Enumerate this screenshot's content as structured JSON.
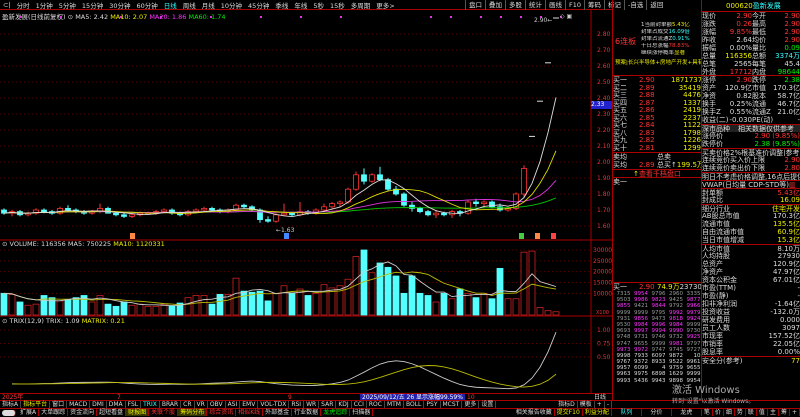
{
  "topbar": {
    "tabs": [
      "分时",
      "1分钟",
      "5分钟",
      "15分钟",
      "30分钟",
      "60分钟",
      "日线",
      "周线",
      "月线",
      "10分钟",
      "45分钟",
      "季线",
      "年线",
      "5秒",
      "15秒",
      "多周期",
      "更多>"
    ],
    "active": "日线",
    "right": [
      "盘口",
      "叠加",
      "多股",
      "统计",
      "画线",
      "F10",
      "筹码",
      "标记",
      "-自选",
      "返回"
    ]
  },
  "chart": {
    "title": "盈新发展(日线前复权)",
    "ma5": "MA5: 2.42",
    "ma10": "MA10: 2.07",
    "ma20": "MA20: 1.86",
    "ma60": "MA60: 1.74",
    "current_tag": "2.33",
    "high_label": "2.90",
    "low_label": "1.63",
    "price_ticks": [
      "2.80",
      "2.70",
      "2.60",
      "2.50",
      "2.40",
      "2.30",
      "2.20",
      "2.10",
      "2.00",
      "1.90",
      "1.80",
      "1.70",
      "1.60"
    ],
    "candles": [
      [
        1.7,
        1.71,
        1.67,
        1.68
      ],
      [
        1.68,
        1.7,
        1.66,
        1.69
      ],
      [
        1.69,
        1.7,
        1.66,
        1.67
      ],
      [
        1.67,
        1.69,
        1.66,
        1.68
      ],
      [
        1.68,
        1.71,
        1.67,
        1.7
      ],
      [
        1.7,
        1.71,
        1.68,
        1.69
      ],
      [
        1.69,
        1.7,
        1.67,
        1.68
      ],
      [
        1.68,
        1.72,
        1.67,
        1.71
      ],
      [
        1.71,
        1.73,
        1.69,
        1.7
      ],
      [
        1.7,
        1.71,
        1.68,
        1.69
      ],
      [
        1.69,
        1.7,
        1.67,
        1.68
      ],
      [
        1.68,
        1.7,
        1.67,
        1.69
      ],
      [
        1.69,
        1.74,
        1.68,
        1.71
      ],
      [
        1.71,
        1.72,
        1.68,
        1.68
      ],
      [
        1.68,
        1.69,
        1.66,
        1.67
      ],
      [
        1.67,
        1.68,
        1.65,
        1.66
      ],
      [
        1.66,
        1.68,
        1.65,
        1.67
      ],
      [
        1.67,
        1.69,
        1.66,
        1.68
      ],
      [
        1.68,
        1.69,
        1.67,
        1.68
      ],
      [
        1.68,
        1.7,
        1.67,
        1.69
      ],
      [
        1.69,
        1.71,
        1.68,
        1.7
      ],
      [
        1.7,
        1.71,
        1.67,
        1.68
      ],
      [
        1.68,
        1.69,
        1.66,
        1.67
      ],
      [
        1.67,
        1.7,
        1.66,
        1.69
      ],
      [
        1.69,
        1.71,
        1.68,
        1.7
      ],
      [
        1.7,
        1.72,
        1.69,
        1.71
      ],
      [
        1.71,
        1.72,
        1.69,
        1.7
      ],
      [
        1.7,
        1.71,
        1.68,
        1.69
      ],
      [
        1.69,
        1.71,
        1.68,
        1.7
      ],
      [
        1.7,
        1.74,
        1.69,
        1.73
      ],
      [
        1.73,
        1.74,
        1.71,
        1.72
      ],
      [
        1.72,
        1.73,
        1.69,
        1.7
      ],
      [
        1.7,
        1.71,
        1.62,
        1.64
      ],
      [
        1.64,
        1.66,
        1.62,
        1.63
      ],
      [
        1.63,
        1.68,
        1.62,
        1.67
      ],
      [
        1.67,
        1.74,
        1.66,
        1.68
      ],
      [
        1.68,
        1.69,
        1.66,
        1.67
      ],
      [
        1.67,
        1.75,
        1.66,
        1.69
      ],
      [
        1.69,
        1.7,
        1.67,
        1.68
      ],
      [
        1.68,
        1.71,
        1.67,
        1.7
      ],
      [
        1.7,
        1.74,
        1.69,
        1.72
      ],
      [
        1.72,
        1.75,
        1.71,
        1.74
      ],
      [
        1.74,
        1.76,
        1.72,
        1.75
      ],
      [
        1.75,
        1.84,
        1.74,
        1.83
      ],
      [
        1.83,
        1.94,
        1.82,
        1.92
      ],
      [
        1.92,
        1.96,
        1.86,
        1.88
      ],
      [
        1.88,
        1.93,
        1.87,
        1.92
      ],
      [
        1.92,
        1.97,
        1.88,
        1.89
      ],
      [
        1.89,
        1.9,
        1.82,
        1.83
      ],
      [
        1.83,
        1.85,
        1.79,
        1.8
      ],
      [
        1.8,
        1.81,
        1.72,
        1.73
      ],
      [
        1.73,
        1.75,
        1.69,
        1.71
      ],
      [
        1.71,
        1.72,
        1.68,
        1.69
      ],
      [
        1.69,
        1.7,
        1.66,
        1.67
      ],
      [
        1.67,
        1.7,
        1.65,
        1.68
      ],
      [
        1.68,
        1.69,
        1.66,
        1.67
      ],
      [
        1.67,
        1.7,
        1.65,
        1.69
      ],
      [
        1.69,
        1.7,
        1.66,
        1.68
      ],
      [
        1.68,
        1.76,
        1.67,
        1.75
      ],
      [
        1.75,
        1.77,
        1.72,
        1.74
      ],
      [
        1.74,
        1.76,
        1.71,
        1.75
      ],
      [
        1.75,
        1.76,
        1.71,
        1.72
      ],
      [
        1.72,
        1.74,
        1.69,
        1.7
      ],
      [
        1.7,
        1.72,
        1.69,
        1.71
      ],
      [
        1.71,
        1.81,
        1.7,
        1.8
      ],
      [
        1.8,
        1.98,
        1.78,
        1.96
      ],
      [
        2.16,
        2.16,
        2.16,
        2.16
      ],
      [
        2.38,
        2.38,
        2.38,
        2.38
      ],
      [
        2.62,
        2.62,
        2.62,
        2.62
      ],
      [
        2.9,
        2.9,
        2.9,
        2.9
      ]
    ]
  },
  "volume": {
    "label": "VOLUME: 116356",
    "ma5": "MA5: 750225",
    "ma10": "MA10: 1120331",
    "ticks": [
      "30000",
      "25000",
      "20000",
      "15000",
      "10000"
    ],
    "unit": "X100",
    "values": [
      10000,
      9500,
      6000,
      4500,
      5000,
      9000,
      8000,
      6500,
      7000,
      8000,
      9000,
      6000,
      9000,
      5000,
      4000,
      6000,
      4500,
      5000,
      4000,
      4000,
      5000,
      4000,
      5500,
      8000,
      9000,
      9000,
      5000,
      9500,
      9500,
      17000,
      11000,
      10500,
      11000,
      6500,
      10000,
      13500,
      10000,
      12000,
      9000,
      10000,
      14000,
      12500,
      13500,
      16500,
      27000,
      30000,
      19500,
      24000,
      22000,
      18000,
      10000,
      18000,
      10000,
      9000,
      6000,
      10000,
      7500,
      12000,
      10000,
      8000,
      10000,
      7500,
      21500,
      7500,
      7500,
      29000,
      29500,
      3500,
      2000,
      1500
    ]
  },
  "trix": {
    "label": "TRIX(12,9)",
    "trix": "TRIX: 1.09",
    "matrix": "MATRIX: 0.21",
    "ticks": [
      "1.00",
      "0.75",
      "0.50"
    ]
  },
  "dateaxis": {
    "year": "2025年",
    "m7": "7",
    "m9": "9",
    "m10": "10",
    "cursor": "2025/09/12/五  26 显示涨幅99.59%",
    "period": "日线"
  },
  "indicators": {
    "items": [
      "指标A",
      "指标平台",
      "窗口",
      "MACD",
      "DMI",
      "DMA",
      "FSL",
      "TRIX",
      "BRAR",
      "CR",
      "VR",
      "OBV",
      "ASI",
      "EMV",
      "VOL-TDX",
      "RSI",
      "WR",
      "SAR",
      "KDJ",
      "CCI",
      "ROC",
      "MTM",
      "BOLL",
      "PSY",
      "MCST",
      "更多",
      "设置"
    ],
    "active": "TRIX",
    "right": [
      "指标D",
      "模板",
      "+",
      "-"
    ]
  },
  "bottombar": {
    "items": [
      "扩展A",
      "大单跟踪",
      "资金流向",
      "超短看盘",
      "财报图",
      "关联个股",
      "筹码分布",
      "综合资讯",
      "相似K线",
      "外部基金",
      "行业数据",
      "龙虎追踪",
      "扫描器"
    ],
    "right": [
      "相关报告收藏",
      "提交F10",
      "利益分配"
    ],
    "tabs": [
      "队列",
      "分价",
      "龙虎",
      "笔",
      "价",
      "细",
      "势",
      "联",
      "值",
      "主",
      "筹",
      "+"
    ]
  },
  "orderbook": {
    "board": "6连板",
    "stats": [
      [
        "1当前封单额",
        "5.43亿"
      ],
      [
        "封单占成交",
        "16.09倍"
      ],
      [
        "封单占流通Z",
        "0.91%"
      ],
      [
        "十日总涨幅",
        "78.83%"
      ],
      [
        "继续涨停概率",
        "显著"
      ]
    ],
    "concept": "预案|长兴半导体+房地产开发+具有",
    "bids": [
      [
        "买一",
        "2.90",
        "1871737"
      ],
      [
        "买二",
        "2.89",
        "35419"
      ],
      [
        "买三",
        "2.88",
        "4476"
      ],
      [
        "买四",
        "2.87",
        "1337"
      ],
      [
        "买五",
        "2.86",
        "2419"
      ],
      [
        "买六",
        "2.85",
        "2237"
      ],
      [
        "买七",
        "2.84",
        "1122"
      ],
      [
        "买八",
        "2.83",
        "1798"
      ],
      [
        "买九",
        "2.82",
        "1226"
      ],
      [
        "买十",
        "2.81",
        "1299"
      ]
    ],
    "ask_avg_label": "卖均",
    "ask_total_label": "总卖",
    "bid_avg_label": "买均",
    "bid_avg": "2.89",
    "bid_total_label": "总买↑",
    "bid_total": "199.5万",
    "view_depth": "查看千档盘口",
    "ask1": "卖一",
    "queue_header": [
      "买一",
      "2.90",
      "74.9万",
      "23730笔"
    ],
    "queue": [
      [
        "7315",
        "9954",
        "9796",
        "2960",
        "3335"
      ],
      [
        "9503",
        "9986",
        "9823",
        "9425",
        "9877"
      ],
      [
        "9855",
        "9421",
        "9844",
        "9792",
        "9966"
      ],
      [
        "9999",
        "9999",
        "9795",
        "9992",
        "9979"
      ],
      [
        "7931",
        "9856",
        "9473",
        "9818",
        "9924"
      ],
      [
        "9530",
        "9984",
        "9996",
        "9984",
        "9999"
      ],
      [
        "9693",
        "9997",
        "9994",
        "9990",
        "9730"
      ],
      [
        "9748",
        "9731",
        "9746",
        "9732",
        "9925"
      ],
      [
        "9747",
        "9655",
        "9999",
        "9981",
        "9797"
      ],
      [
        "9973",
        "9972",
        "9747",
        "9745",
        "9727"
      ],
      [
        "9998",
        "7933",
        "6097",
        "9872",
        "10"
      ],
      [
        "9767",
        "9372",
        "8933",
        "9522",
        "9961"
      ],
      [
        "9957",
        "6099",
        "4",
        "9759",
        "9655"
      ],
      [
        "9963",
        "9975",
        "6898",
        "1629",
        "9999"
      ],
      [
        "9993",
        "5436",
        "9943",
        "9898",
        "9954"
      ]
    ]
  },
  "rightpanel": {
    "code": "000620",
    "name": "盈新发展",
    "quote": [
      [
        "现价",
        "2.90",
        "今开",
        "2.90"
      ],
      [
        "涨跌",
        "0.26",
        "最高",
        "2.90"
      ],
      [
        "涨幅",
        "9.85%",
        "最低",
        "2.90"
      ],
      [
        "昨收",
        "2.64",
        "均价",
        "2.90"
      ],
      [
        "振幅",
        "0.00%",
        "量比",
        "0.09"
      ],
      [
        "总量",
        "116356",
        "总额",
        "3374万"
      ],
      [
        "总笔",
        "2565",
        "每笔",
        "45.4"
      ],
      [
        "外盘",
        "17712",
        "内盘",
        "98644"
      ]
    ],
    "fund": [
      [
        "涨停",
        "2.90",
        "跌停",
        "2.38"
      ],
      [
        "资产",
        "120.9亿",
        "市值",
        "170.3亿"
      ],
      [
        "净资",
        "0.82",
        "股本",
        "58.7亿"
      ],
      [
        "换手",
        "0.25%",
        "流通",
        "46.7亿"
      ],
      [
        "换手Z",
        "0.55%",
        "流通Z",
        "21.0亿"
      ],
      [
        "收益(二)",
        "-0.030",
        "PE(动)",
        "-"
      ]
    ],
    "notice": [
      "深市品种",
      "相关数据仅供参考"
    ],
    "limits": [
      [
        "涨停价",
        "2.90 (9.85%)"
      ],
      [
        "跌停价",
        "2.38 (9.85%)"
      ]
    ],
    "rules": [
      "买卖价格2%根基准价调整|参考",
      [
        "连续竞价买入价上限",
        "2.90"
      ],
      [
        "连续竞价卖出价下限",
        "2.80"
      ],
      "明日不考虑价格调整,16点后提供",
      "VWAP(日均量 CDP-STD等)"
    ],
    "seal": [
      [
        "封单额",
        "5.43亿"
      ],
      [
        "封成比",
        "16.09"
      ]
    ],
    "industry": [
      [
        "细分行业",
        "住宅开发"
      ],
      [
        "AB股总市值",
        "170.3亿"
      ],
      [
        "流通市值",
        "135.5亿"
      ],
      [
        "自由流通市值",
        "60.9亿"
      ],
      [
        "当日市值增减",
        "15.3亿"
      ]
    ],
    "finance": [
      [
        "人均市值",
        "8.10万"
      ],
      [
        "人均持股",
        "27930"
      ],
      [
        "总资产",
        "120.9亿"
      ],
      [
        "净资产",
        "47.97亿"
      ],
      [
        "资本公积金",
        "67.01亿"
      ],
      [
        "市盈(TTM)",
        "-"
      ],
      [
        "市盈(静)",
        "-"
      ],
      [
        "扣非净利润",
        "-1.64亿"
      ],
      [
        "投资收益",
        "-132.0万"
      ],
      [
        "研发费用",
        "0.000"
      ],
      [
        "员工人数",
        "3097"
      ],
      [
        "市现率",
        "157.52亿"
      ],
      [
        "市销率",
        "22.05亿"
      ],
      [
        "股息率",
        "0.00%"
      ]
    ],
    "safety": [
      "安全分(参考)",
      "77"
    ]
  },
  "watermark": {
    "line1": "激活 Windows",
    "line2": "转到\"设置\"以激活 Windows。"
  }
}
